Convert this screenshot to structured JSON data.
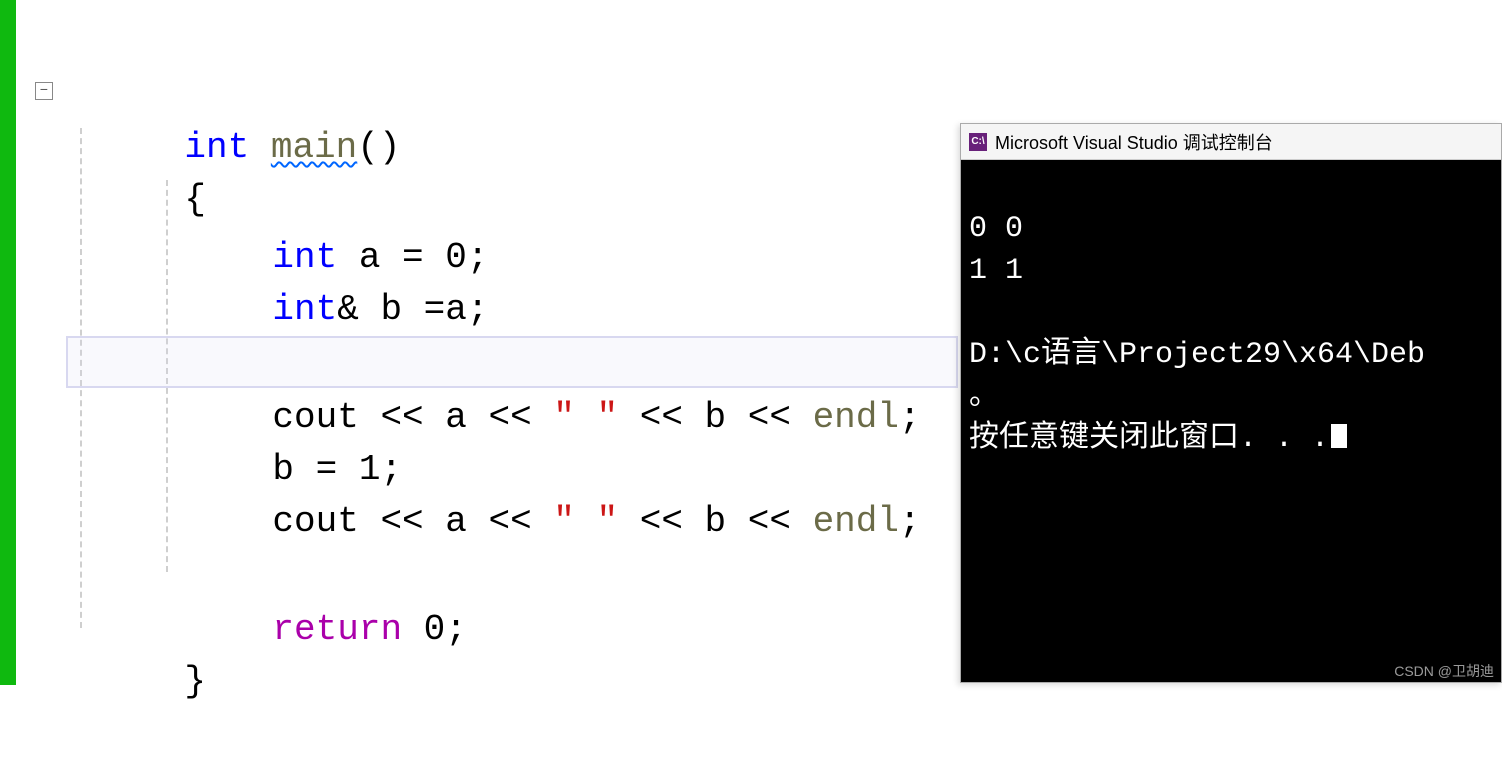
{
  "editor": {
    "collapse_symbol": "−",
    "lines": {
      "l1": {
        "kw": "int",
        "fn": "main",
        "parens": "()"
      },
      "l2": {
        "brace": "{"
      },
      "l3": {
        "kw": "int",
        "var": "a",
        "rest": " = 0;"
      },
      "l4": {
        "kw": "int",
        "amp": "&",
        "var": "b",
        "rest": " =a;"
      },
      "l5": {
        "cout": "cout",
        "op1": " << ",
        "v1": "a",
        "op2": " << ",
        "str": "\" \"",
        "op3": " << ",
        "v2": "b",
        "op4": " << ",
        "endl": "endl",
        "semi": ";"
      },
      "l6": {
        "v": "b",
        "rest": " = 1;"
      },
      "l7": {
        "cout": "cout",
        "op1": " << ",
        "v1": "a",
        "op2": " << ",
        "str": "\" \"",
        "op3": " << ",
        "v2": "b",
        "op4": " << ",
        "endl": "endl",
        "semi": ";"
      },
      "l8": {
        "ret": "return",
        "val": " 0;"
      },
      "l9": {
        "brace": "}"
      }
    }
  },
  "console": {
    "icon": "C:\\",
    "title": "Microsoft Visual Studio 调试控制台",
    "lines": {
      "o1": "0 0",
      "o2": "1 1",
      "blank": "",
      "path": "D:\\c语言\\Project29\\x64\\Deb",
      "deg": "。",
      "prompt": "按任意键关闭此窗口. . ."
    }
  },
  "watermark": "CSDN @卫胡迪"
}
